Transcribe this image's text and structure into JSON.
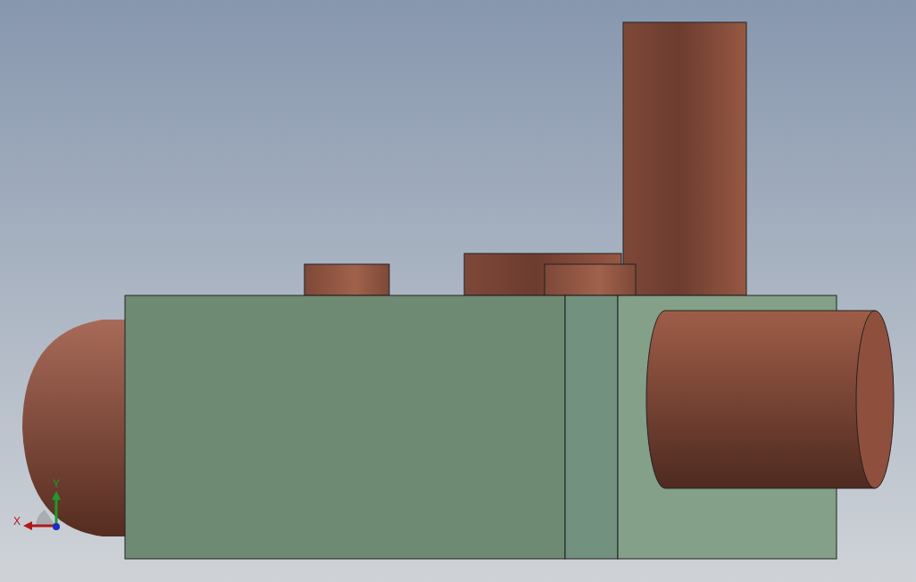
{
  "triad": {
    "x_label": "X",
    "y_label": "Y"
  }
}
